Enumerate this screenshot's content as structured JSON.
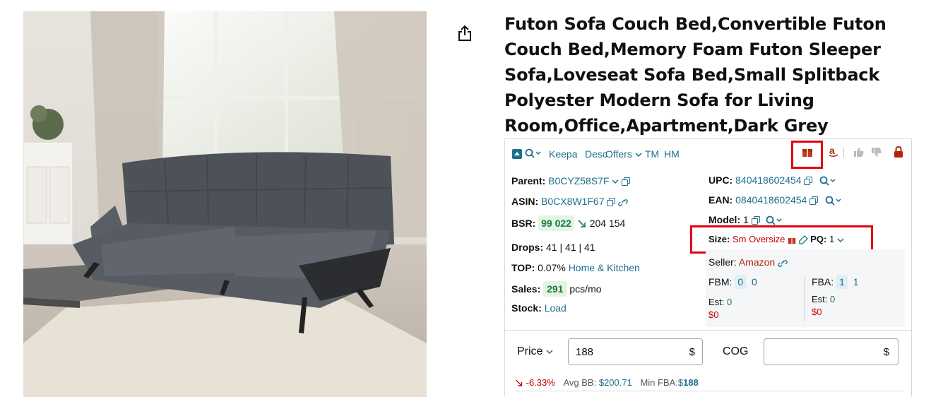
{
  "product": {
    "title": "Futon Sofa Couch Bed,Convertible Futon Couch Bed,Memory Foam Futon Sleeper Sofa,Loveseat Sofa Bed,Small Splitback Polyester Modern Sofa for Living Room,Office,Apartment,Dark Grey"
  },
  "toolbar": {
    "keepa_label": "Keepa",
    "desc_label": "Desc",
    "offers_label": "Offers",
    "tm_label": "TM",
    "hm_label": "HM"
  },
  "info": {
    "parent_label": "Parent:",
    "parent_value": "B0CYZ58S7F",
    "asin_label": "ASIN:",
    "asin_value": "B0CX8W1F67",
    "bsr_label": "BSR:",
    "bsr_value": "99 022",
    "bsr_prev": "204 154",
    "drops_label": "Drops:",
    "drops_value": "41 | 41 | 41",
    "top_label": "TOP:",
    "top_percent": "0.07%",
    "top_category": "Home & Kitchen",
    "sales_label": "Sales:",
    "sales_value": "291",
    "sales_unit": "pcs/mo",
    "stock_label": "Stock:",
    "stock_link": "Load",
    "upc_label": "UPC:",
    "upc_value": "840418602454",
    "ean_label": "EAN:",
    "ean_value": "0840418602454",
    "model_label": "Model:",
    "model_value": "1",
    "size_label": "Size:",
    "size_value": "Sm Oversize",
    "pq_label": "PQ:",
    "pq_value": "1"
  },
  "seller": {
    "label": "Seller:",
    "name": "Amazon",
    "fbm_label": "FBM:",
    "fbm_count": "0",
    "fbm_count2": "0",
    "fba_label": "FBA:",
    "fba_count": "1",
    "fba_count2": "1",
    "est_label": "Est:",
    "fbm_est": "0",
    "fbm_money": "$0",
    "fba_est": "0",
    "fba_money": "$0"
  },
  "pricing": {
    "price_label": "Price",
    "price_value": "188",
    "currency": "$",
    "cog_label": "COG",
    "cog_value": "",
    "change": "-6.33%",
    "avg_bb_label": "Avg BB:",
    "avg_bb_value": "$200.71",
    "min_fba_label": "Min FBA:",
    "min_fba_currency": "$",
    "min_fba_value": "188"
  },
  "colors": {
    "teal": "#1f6f8b",
    "highlight": "#e4000f",
    "green": "#1c7a3a",
    "red": "#c7511f"
  },
  "icons": [
    "share-icon",
    "search-icon",
    "chevron-down-icon",
    "copy-icon",
    "link-icon",
    "arrow-down-icon",
    "package-icon",
    "amazon-icon",
    "thumbs-up-icon",
    "thumbs-down-icon",
    "lock-icon",
    "edit-icon"
  ]
}
